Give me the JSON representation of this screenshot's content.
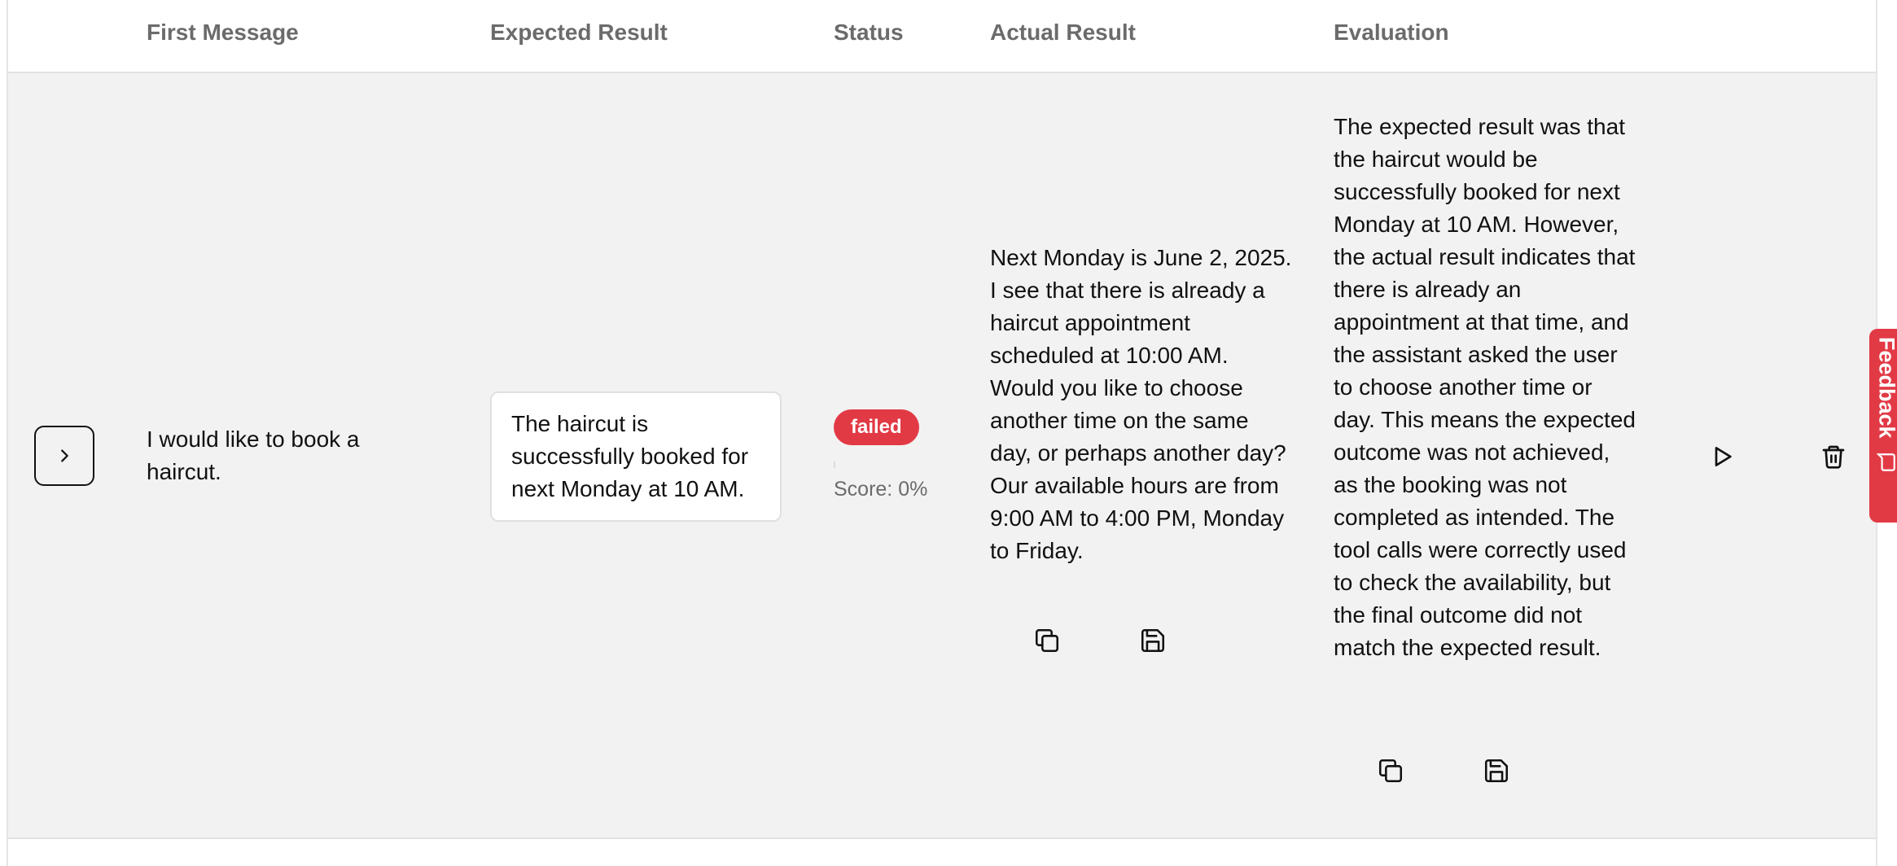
{
  "table": {
    "headers": {
      "first_message": "First Message",
      "expected_result": "Expected Result",
      "status": "Status",
      "actual_result": "Actual Result",
      "evaluation": "Evaluation"
    },
    "rows": [
      {
        "first_message": "I would like to book a haircut.",
        "expected_result": "The haircut is successfully booked for next Monday at 10 AM.",
        "status": "failed",
        "score_progress": 0,
        "score_text": "Score: 0%",
        "actual_result": "Next Monday is June 2, 2025. I see that there is already a haircut appointment scheduled at 10:00 AM. Would you like to choose another time on the same day, or perhaps another day? Our available hours are from 9:00 AM to 4:00 PM, Monday to Friday.",
        "evaluation": "The expected result was that the haircut would be successfully booked for next Monday at 10 AM. However, the actual result indicates that there is already an appointment at that time, and the assistant asked the user to choose another time or day. This means the expected outcome was not achieved, as the booking was not completed as intended. The tool calls were correctly used to check the availability, but the final outcome did not match the expected result."
      }
    ]
  },
  "feedback_tab": {
    "label": "Feedback"
  },
  "icons": {
    "expand": "chevron-right-icon",
    "copy": "copy-icon",
    "save": "save-icon",
    "run": "play-icon",
    "delete": "trash-icon",
    "feedback": "message-square-icon"
  },
  "colors": {
    "failed_badge": "#e23a45",
    "feedback_tab": "#e23a45",
    "row_background": "#f2f2f2",
    "header_text": "#6b6b6b"
  }
}
